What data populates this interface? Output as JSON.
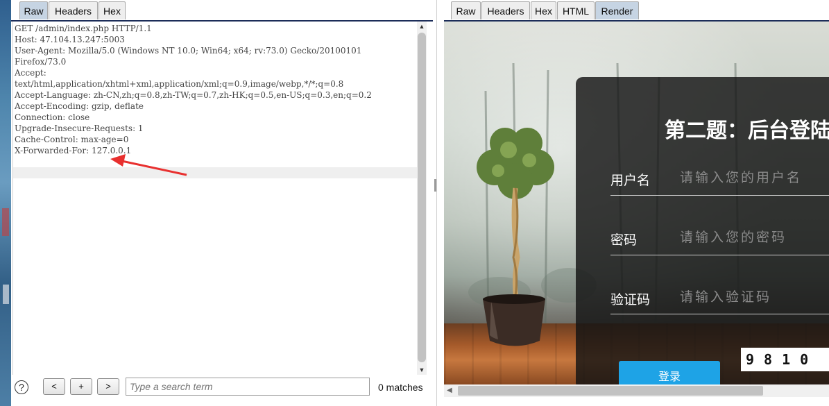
{
  "request_panel": {
    "tabs": [
      "Raw",
      "Headers",
      "Hex"
    ],
    "active_tab": "Raw",
    "request_lines": [
      "GET /admin/index.php HTTP/1.1",
      "Host: 47.104.13.247:5003",
      "User-Agent: Mozilla/5.0 (Windows NT 10.0; Win64; x64; rv:73.0) Gecko/20100101",
      "Firefox/73.0",
      "Accept:",
      "text/html,application/xhtml+xml,application/xml;q=0.9,image/webp,*/*;q=0.8",
      "Accept-Language: zh-CN,zh;q=0.8,zh-TW;q=0.7,zh-HK;q=0.5,en-US;q=0.3,en;q=0.2",
      "Accept-Encoding: gzip, deflate",
      "Connection: close",
      "Upgrade-Insecure-Requests: 1",
      "Cache-Control: max-age=0",
      "X-Forwarded-For: 127.0.0.1"
    ],
    "annotation_color": "#e8302f"
  },
  "search_bar": {
    "help_label": "?",
    "prev_label": "<",
    "add_label": "+",
    "next_label": ">",
    "placeholder": "Type a search term",
    "matches_text": "0 matches"
  },
  "response_panel": {
    "tabs": [
      "Raw",
      "Headers",
      "Hex",
      "HTML",
      "Render"
    ],
    "active_tab": "Render",
    "rendered_page": {
      "title": "第二题：后台登陆",
      "username_label": "用户名",
      "username_placeholder": "请输入您的用户名",
      "password_label": "密码",
      "password_placeholder": "请输入您的密码",
      "captcha_label": "验证码",
      "captcha_placeholder": "请输入验证码",
      "captcha_image_text": "9810",
      "login_button": "登录",
      "button_color": "#1ea3e6"
    }
  }
}
